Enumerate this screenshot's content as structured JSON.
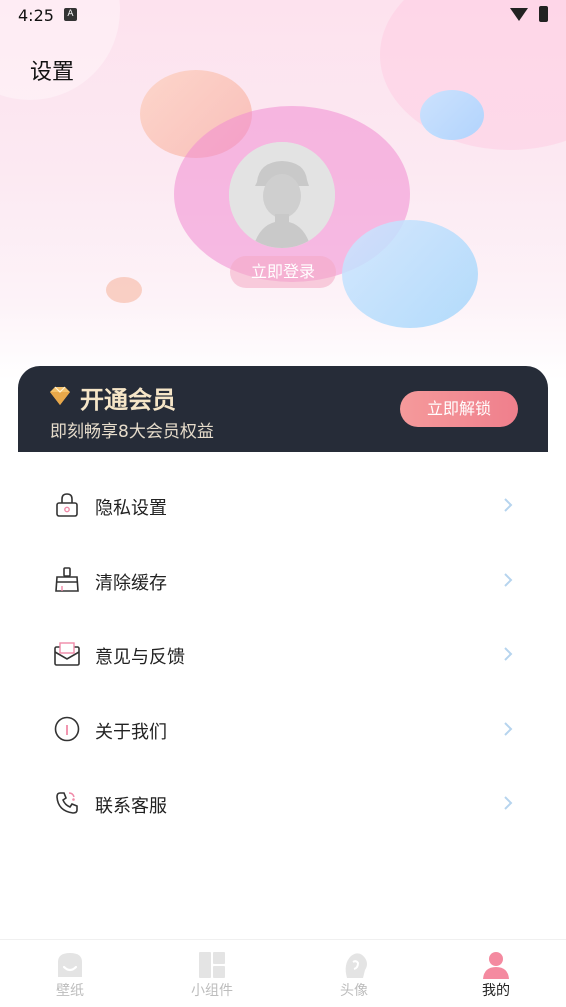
{
  "status_bar": {
    "time": "4:25",
    "indicator": "A"
  },
  "header": {
    "title": "设置"
  },
  "profile": {
    "login_label": "立即登录"
  },
  "vip": {
    "title": "开通会员",
    "subtitle": "即刻畅享8大会员权益",
    "button_label": "立即解锁",
    "accent": "#ef7f8c"
  },
  "menu": [
    {
      "label": "隐私设置",
      "icon": "lock-icon"
    },
    {
      "label": "清除缓存",
      "icon": "broom-icon"
    },
    {
      "label": "意见与反馈",
      "icon": "envelope-icon"
    },
    {
      "label": "关于我们",
      "icon": "info-icon"
    },
    {
      "label": "联系客服",
      "icon": "phone-icon"
    }
  ],
  "nav": [
    {
      "label": "壁纸",
      "icon": "wallpaper-icon",
      "active": false
    },
    {
      "label": "小组件",
      "icon": "widget-icon",
      "active": false
    },
    {
      "label": "头像",
      "icon": "avatar-icon",
      "active": false
    },
    {
      "label": "我的",
      "icon": "profile-icon",
      "active": true
    }
  ]
}
